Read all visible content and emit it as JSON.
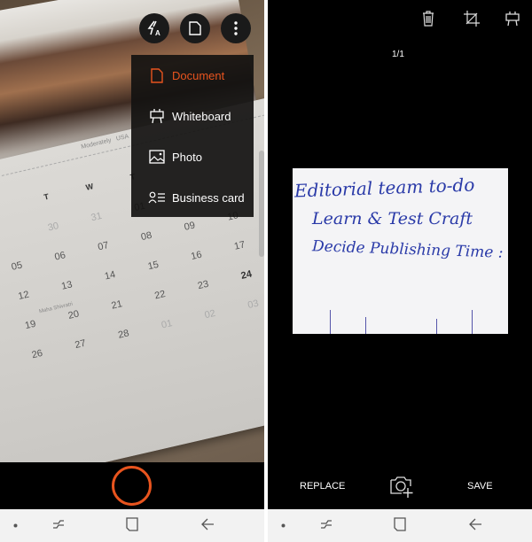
{
  "camera": {
    "top_buttons": [
      {
        "name": "flash-auto",
        "icon": "flash-auto-icon"
      },
      {
        "name": "mode",
        "icon": "document-icon"
      },
      {
        "name": "more",
        "icon": "more-vertical-icon"
      }
    ],
    "mode_menu": [
      {
        "label": "Document",
        "icon": "document-icon",
        "active": true
      },
      {
        "label": "Whiteboard",
        "icon": "whiteboard-icon",
        "active": false
      },
      {
        "label": "Photo",
        "icon": "photo-icon",
        "active": false
      },
      {
        "label": "Business card",
        "icon": "business-card-icon",
        "active": false
      }
    ],
    "calendar": {
      "header_text": "Moderately   USA",
      "weekdays": [
        "",
        "T",
        "W",
        "T",
        "",
        "",
        ""
      ],
      "rows": [
        [
          "",
          "30",
          "31",
          "01",
          "",
          "",
          ""
        ],
        [
          "05",
          "06",
          "07",
          "08",
          "09",
          "10",
          ""
        ],
        [
          "12",
          "13",
          "14",
          "15",
          "16",
          "17",
          ""
        ],
        [
          "19",
          "20",
          "21",
          "22",
          "23",
          "24",
          ""
        ],
        [
          "26",
          "27",
          "28",
          "01",
          "02",
          "03",
          ""
        ]
      ],
      "holiday": "Maha Shivratri"
    },
    "shutter_color": "#e8541e"
  },
  "preview": {
    "toolbar_icons": [
      "delete-icon",
      "crop-icon",
      "whiteboard-icon"
    ],
    "page_indicator": "1/1",
    "note_lines": [
      "Editorial team to-do",
      "Learn & Test Craft",
      "Decide Publishing Time :"
    ],
    "replace_label": "REPLACE",
    "save_label": "SAVE",
    "add_capture_icon": "camera-add-icon"
  },
  "navbar": {
    "icons": [
      "dot-icon",
      "recent-apps-icon",
      "home-icon",
      "back-icon"
    ]
  },
  "colors": {
    "accent": "#e8541e",
    "background": "#000000",
    "navbar": "#f2f2f2",
    "ink": "#2a3aa8"
  }
}
